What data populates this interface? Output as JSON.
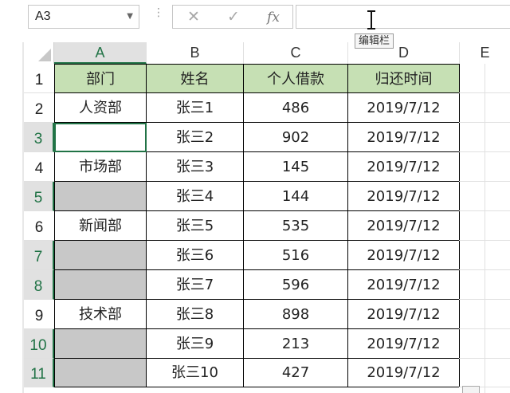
{
  "formula_bar": {
    "name_box": "A3",
    "cancel_icon": "✕",
    "enter_icon": "✓",
    "fx_label": "fx",
    "formula_value": "",
    "tooltip": "编辑栏"
  },
  "columns": [
    "A",
    "B",
    "C",
    "D",
    "E"
  ],
  "rows": [
    "1",
    "2",
    "3",
    "4",
    "5",
    "6",
    "7",
    "8",
    "9",
    "10",
    "11"
  ],
  "header": {
    "dept": "部门",
    "name": "姓名",
    "loan": "个人借款",
    "date": "归还时间"
  },
  "data": [
    {
      "dept": "人资部",
      "name": "张三1",
      "loan": "486",
      "date": "2019/7/12"
    },
    {
      "dept": "",
      "name": "张三2",
      "loan": "902",
      "date": "2019/7/12"
    },
    {
      "dept": "市场部",
      "name": "张三3",
      "loan": "145",
      "date": "2019/7/12"
    },
    {
      "dept": "",
      "name": "张三4",
      "loan": "144",
      "date": "2019/7/12"
    },
    {
      "dept": "新闻部",
      "name": "张三5",
      "loan": "535",
      "date": "2019/7/12"
    },
    {
      "dept": "",
      "name": "张三6",
      "loan": "516",
      "date": "2019/7/12"
    },
    {
      "dept": "",
      "name": "张三7",
      "loan": "596",
      "date": "2019/7/12"
    },
    {
      "dept": "技术部",
      "name": "张三8",
      "loan": "898",
      "date": "2019/7/12"
    },
    {
      "dept": "",
      "name": "张三9",
      "loan": "213",
      "date": "2019/7/12"
    },
    {
      "dept": "",
      "name": "张三10",
      "loan": "427",
      "date": "2019/7/12"
    }
  ],
  "colors": {
    "header_fill": "#c6e0b4",
    "gray_fill": "#c8c8c8",
    "accent": "#217346"
  }
}
